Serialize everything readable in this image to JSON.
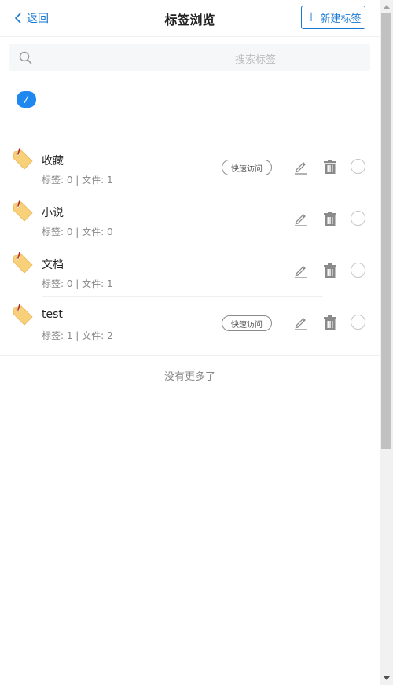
{
  "header": {
    "back_label": "返回",
    "title": "标签浏览",
    "new_tag_label": "新建标签"
  },
  "search": {
    "placeholder": "搜索标签"
  },
  "path": {
    "root_label": "/"
  },
  "tags": [
    {
      "name": "收藏",
      "meta": "标签: 0 | 文件: 1",
      "quick_access": "快速访问"
    },
    {
      "name": "小说",
      "meta": "标签: 0 | 文件: 0",
      "quick_access": ""
    },
    {
      "name": "文档",
      "meta": "标签: 0 | 文件: 1",
      "quick_access": ""
    },
    {
      "name": "test",
      "meta": "标签: 1 | 文件: 2",
      "quick_access": "快速访问"
    }
  ],
  "footer": {
    "no_more": "没有更多了"
  },
  "colors": {
    "accent": "#1677d2",
    "chip": "#1e88f0",
    "tag_icon": "#f9d07a",
    "tag_pin": "#d9534f"
  },
  "icons": {
    "back": "chevron-left-icon",
    "new": "plus-icon",
    "search": "search-icon",
    "tag": "tag-icon",
    "edit": "pencil-icon",
    "delete": "trash-icon",
    "select": "radio-icon"
  }
}
